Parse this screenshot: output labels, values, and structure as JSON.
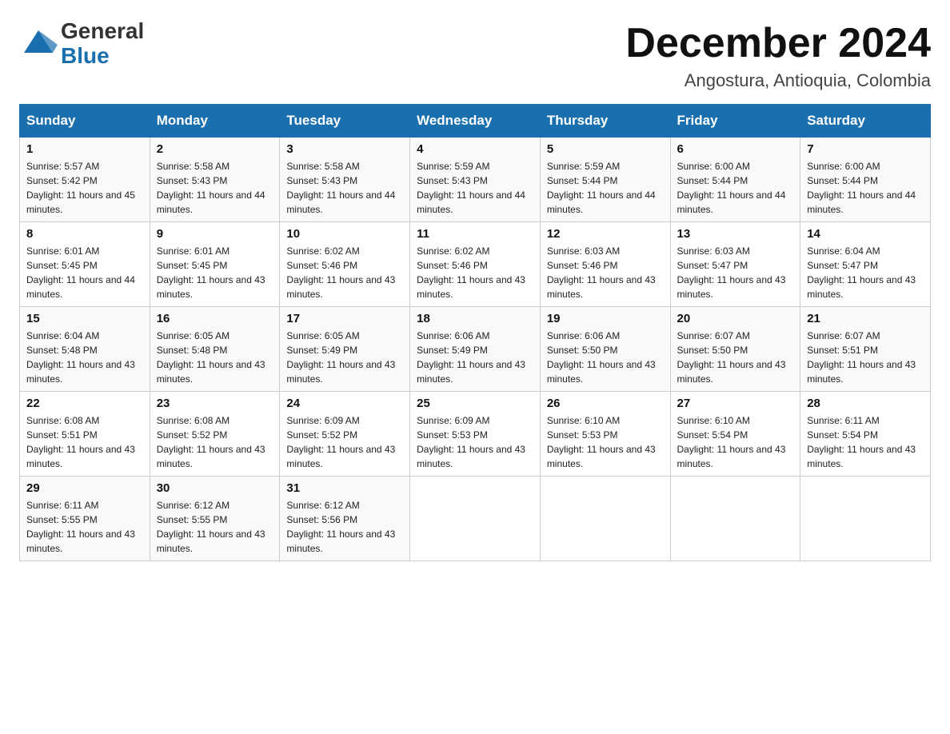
{
  "header": {
    "logo_general": "General",
    "logo_blue": "Blue",
    "title": "December 2024",
    "subtitle": "Angostura, Antioquia, Colombia"
  },
  "calendar": {
    "headers": [
      "Sunday",
      "Monday",
      "Tuesday",
      "Wednesday",
      "Thursday",
      "Friday",
      "Saturday"
    ],
    "weeks": [
      [
        {
          "day": "",
          "sunrise": "",
          "sunset": "",
          "daylight": ""
        },
        {
          "day": "",
          "sunrise": "",
          "sunset": "",
          "daylight": ""
        },
        {
          "day": "",
          "sunrise": "",
          "sunset": "",
          "daylight": ""
        },
        {
          "day": "",
          "sunrise": "",
          "sunset": "",
          "daylight": ""
        },
        {
          "day": "",
          "sunrise": "",
          "sunset": "",
          "daylight": ""
        },
        {
          "day": "",
          "sunrise": "",
          "sunset": "",
          "daylight": ""
        },
        {
          "day": "",
          "sunrise": "",
          "sunset": "",
          "daylight": ""
        }
      ],
      [
        {
          "day": "1",
          "sunrise": "Sunrise: 5:57 AM",
          "sunset": "Sunset: 5:42 PM",
          "daylight": "Daylight: 11 hours and 45 minutes."
        },
        {
          "day": "2",
          "sunrise": "Sunrise: 5:58 AM",
          "sunset": "Sunset: 5:43 PM",
          "daylight": "Daylight: 11 hours and 44 minutes."
        },
        {
          "day": "3",
          "sunrise": "Sunrise: 5:58 AM",
          "sunset": "Sunset: 5:43 PM",
          "daylight": "Daylight: 11 hours and 44 minutes."
        },
        {
          "day": "4",
          "sunrise": "Sunrise: 5:59 AM",
          "sunset": "Sunset: 5:43 PM",
          "daylight": "Daylight: 11 hours and 44 minutes."
        },
        {
          "day": "5",
          "sunrise": "Sunrise: 5:59 AM",
          "sunset": "Sunset: 5:44 PM",
          "daylight": "Daylight: 11 hours and 44 minutes."
        },
        {
          "day": "6",
          "sunrise": "Sunrise: 6:00 AM",
          "sunset": "Sunset: 5:44 PM",
          "daylight": "Daylight: 11 hours and 44 minutes."
        },
        {
          "day": "7",
          "sunrise": "Sunrise: 6:00 AM",
          "sunset": "Sunset: 5:44 PM",
          "daylight": "Daylight: 11 hours and 44 minutes."
        }
      ],
      [
        {
          "day": "8",
          "sunrise": "Sunrise: 6:01 AM",
          "sunset": "Sunset: 5:45 PM",
          "daylight": "Daylight: 11 hours and 44 minutes."
        },
        {
          "day": "9",
          "sunrise": "Sunrise: 6:01 AM",
          "sunset": "Sunset: 5:45 PM",
          "daylight": "Daylight: 11 hours and 43 minutes."
        },
        {
          "day": "10",
          "sunrise": "Sunrise: 6:02 AM",
          "sunset": "Sunset: 5:46 PM",
          "daylight": "Daylight: 11 hours and 43 minutes."
        },
        {
          "day": "11",
          "sunrise": "Sunrise: 6:02 AM",
          "sunset": "Sunset: 5:46 PM",
          "daylight": "Daylight: 11 hours and 43 minutes."
        },
        {
          "day": "12",
          "sunrise": "Sunrise: 6:03 AM",
          "sunset": "Sunset: 5:46 PM",
          "daylight": "Daylight: 11 hours and 43 minutes."
        },
        {
          "day": "13",
          "sunrise": "Sunrise: 6:03 AM",
          "sunset": "Sunset: 5:47 PM",
          "daylight": "Daylight: 11 hours and 43 minutes."
        },
        {
          "day": "14",
          "sunrise": "Sunrise: 6:04 AM",
          "sunset": "Sunset: 5:47 PM",
          "daylight": "Daylight: 11 hours and 43 minutes."
        }
      ],
      [
        {
          "day": "15",
          "sunrise": "Sunrise: 6:04 AM",
          "sunset": "Sunset: 5:48 PM",
          "daylight": "Daylight: 11 hours and 43 minutes."
        },
        {
          "day": "16",
          "sunrise": "Sunrise: 6:05 AM",
          "sunset": "Sunset: 5:48 PM",
          "daylight": "Daylight: 11 hours and 43 minutes."
        },
        {
          "day": "17",
          "sunrise": "Sunrise: 6:05 AM",
          "sunset": "Sunset: 5:49 PM",
          "daylight": "Daylight: 11 hours and 43 minutes."
        },
        {
          "day": "18",
          "sunrise": "Sunrise: 6:06 AM",
          "sunset": "Sunset: 5:49 PM",
          "daylight": "Daylight: 11 hours and 43 minutes."
        },
        {
          "day": "19",
          "sunrise": "Sunrise: 6:06 AM",
          "sunset": "Sunset: 5:50 PM",
          "daylight": "Daylight: 11 hours and 43 minutes."
        },
        {
          "day": "20",
          "sunrise": "Sunrise: 6:07 AM",
          "sunset": "Sunset: 5:50 PM",
          "daylight": "Daylight: 11 hours and 43 minutes."
        },
        {
          "day": "21",
          "sunrise": "Sunrise: 6:07 AM",
          "sunset": "Sunset: 5:51 PM",
          "daylight": "Daylight: 11 hours and 43 minutes."
        }
      ],
      [
        {
          "day": "22",
          "sunrise": "Sunrise: 6:08 AM",
          "sunset": "Sunset: 5:51 PM",
          "daylight": "Daylight: 11 hours and 43 minutes."
        },
        {
          "day": "23",
          "sunrise": "Sunrise: 6:08 AM",
          "sunset": "Sunset: 5:52 PM",
          "daylight": "Daylight: 11 hours and 43 minutes."
        },
        {
          "day": "24",
          "sunrise": "Sunrise: 6:09 AM",
          "sunset": "Sunset: 5:52 PM",
          "daylight": "Daylight: 11 hours and 43 minutes."
        },
        {
          "day": "25",
          "sunrise": "Sunrise: 6:09 AM",
          "sunset": "Sunset: 5:53 PM",
          "daylight": "Daylight: 11 hours and 43 minutes."
        },
        {
          "day": "26",
          "sunrise": "Sunrise: 6:10 AM",
          "sunset": "Sunset: 5:53 PM",
          "daylight": "Daylight: 11 hours and 43 minutes."
        },
        {
          "day": "27",
          "sunrise": "Sunrise: 6:10 AM",
          "sunset": "Sunset: 5:54 PM",
          "daylight": "Daylight: 11 hours and 43 minutes."
        },
        {
          "day": "28",
          "sunrise": "Sunrise: 6:11 AM",
          "sunset": "Sunset: 5:54 PM",
          "daylight": "Daylight: 11 hours and 43 minutes."
        }
      ],
      [
        {
          "day": "29",
          "sunrise": "Sunrise: 6:11 AM",
          "sunset": "Sunset: 5:55 PM",
          "daylight": "Daylight: 11 hours and 43 minutes."
        },
        {
          "day": "30",
          "sunrise": "Sunrise: 6:12 AM",
          "sunset": "Sunset: 5:55 PM",
          "daylight": "Daylight: 11 hours and 43 minutes."
        },
        {
          "day": "31",
          "sunrise": "Sunrise: 6:12 AM",
          "sunset": "Sunset: 5:56 PM",
          "daylight": "Daylight: 11 hours and 43 minutes."
        },
        {
          "day": "",
          "sunrise": "",
          "sunset": "",
          "daylight": ""
        },
        {
          "day": "",
          "sunrise": "",
          "sunset": "",
          "daylight": ""
        },
        {
          "day": "",
          "sunrise": "",
          "sunset": "",
          "daylight": ""
        },
        {
          "day": "",
          "sunrise": "",
          "sunset": "",
          "daylight": ""
        }
      ]
    ]
  }
}
